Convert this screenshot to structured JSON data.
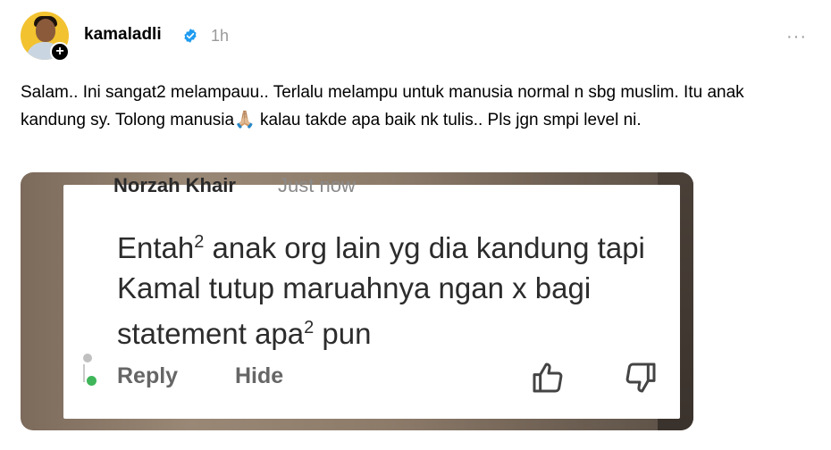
{
  "post": {
    "username": "kamaladli",
    "time": "1h",
    "more": "···",
    "text": "Salam.. Ini sangat2 melampauu.. Terlalu melampu untuk manusia normal n sbg muslim. Itu anak kandung sy. Tolong manusia🙏🏼 kalau takde apa baik nk tulis.. Pls jgn smpi level ni."
  },
  "screenshot": {
    "cut_name": "Norzah Khair",
    "cut_time": "Just now",
    "comment_part1": "Entah",
    "comment_sup1": "2",
    "comment_part2": " anak org lain yg dia kandung tapi Kamal tutup maruahnya ngan x bagi statement apa",
    "comment_sup2": "2",
    "comment_part3": " pun",
    "reply_label": "Reply",
    "hide_label": "Hide"
  },
  "icons": {
    "verified": "verified-badge-icon",
    "follow": "plus-icon",
    "like": "thumbs-up-icon",
    "dislike": "thumbs-down-icon"
  },
  "colors": {
    "verified_blue": "#1d9bf0",
    "avatar_bg": "#f2c230",
    "muted": "#999999"
  }
}
